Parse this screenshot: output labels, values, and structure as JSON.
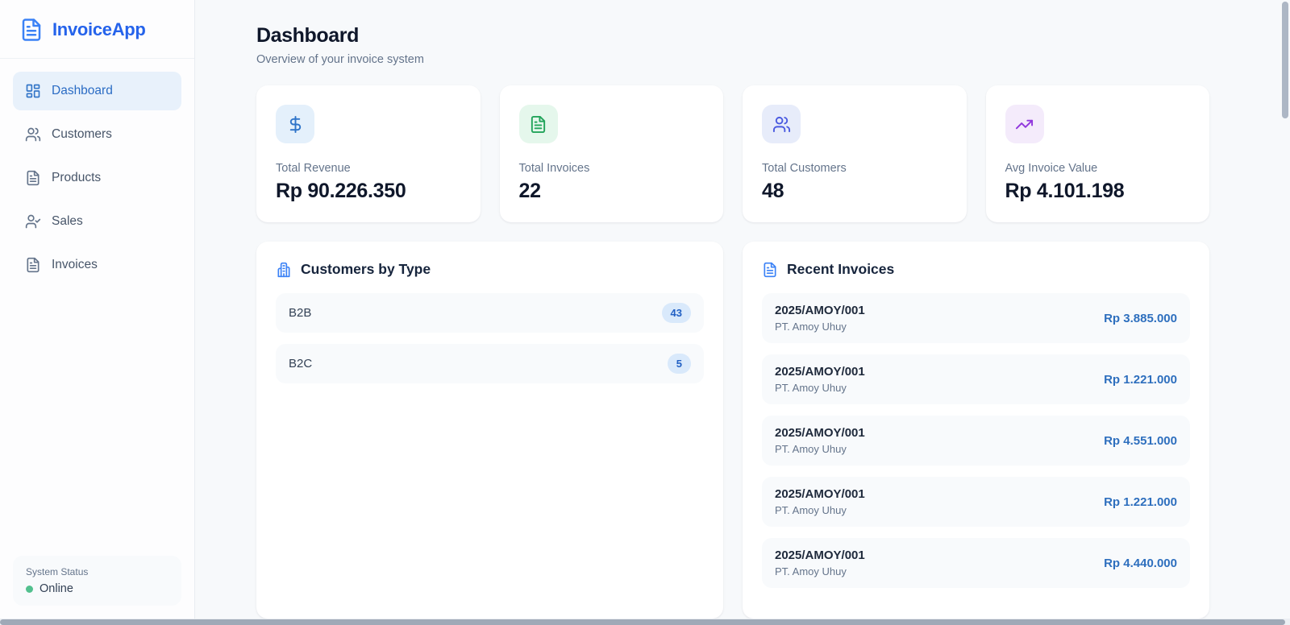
{
  "app": {
    "title": "InvoiceApp",
    "accent_color": "#2563eb"
  },
  "sidebar": {
    "items": [
      {
        "label": "Dashboard",
        "icon": "layout-dashboard-icon",
        "active": true
      },
      {
        "label": "Customers",
        "icon": "users-icon",
        "active": false
      },
      {
        "label": "Products",
        "icon": "file-text-icon",
        "active": false
      },
      {
        "label": "Sales",
        "icon": "user-check-icon",
        "active": false
      },
      {
        "label": "Invoices",
        "icon": "file-text-icon",
        "active": false
      }
    ],
    "status": {
      "label": "System Status",
      "value": "Online",
      "dot_color": "#52c08e"
    }
  },
  "header": {
    "title": "Dashboard",
    "subtitle": "Overview of your invoice system"
  },
  "stats": [
    {
      "label": "Total Revenue",
      "value": "Rp 90.226.350",
      "icon": "dollar-icon",
      "icon_color": "#2e74c9",
      "icon_bg": "#e4f0fb"
    },
    {
      "label": "Total Invoices",
      "value": "22",
      "icon": "file-text-icon",
      "icon_color": "#23a45b",
      "icon_bg": "#e5f7ec"
    },
    {
      "label": "Total Customers",
      "value": "48",
      "icon": "users-icon",
      "icon_color": "#4a5ae0",
      "icon_bg": "#e7ecfa"
    },
    {
      "label": "Avg Invoice Value",
      "value": "Rp 4.101.198",
      "icon": "trending-up-icon",
      "icon_color": "#9137dd",
      "icon_bg": "#f4ebfb"
    }
  ],
  "customers_by_type": {
    "title": "Customers by Type",
    "icon": "building-icon",
    "rows": [
      {
        "label": "B2B",
        "count": "43"
      },
      {
        "label": "B2C",
        "count": "5"
      }
    ],
    "badge_bg": "#d9e9fb",
    "badge_color": "#2160c4"
  },
  "recent_invoices": {
    "title": "Recent Invoices",
    "icon": "file-text-icon",
    "amount_color": "#2e6fbe",
    "rows": [
      {
        "number": "2025/AMOY/001",
        "customer": "PT. Amoy Uhuy",
        "amount": "Rp 3.885.000"
      },
      {
        "number": "2025/AMOY/001",
        "customer": "PT. Amoy Uhuy",
        "amount": "Rp 1.221.000"
      },
      {
        "number": "2025/AMOY/001",
        "customer": "PT. Amoy Uhuy",
        "amount": "Rp 4.551.000"
      },
      {
        "number": "2025/AMOY/001",
        "customer": "PT. Amoy Uhuy",
        "amount": "Rp 1.221.000"
      },
      {
        "number": "2025/AMOY/001",
        "customer": "PT. Amoy Uhuy",
        "amount": "Rp 4.440.000"
      }
    ]
  }
}
